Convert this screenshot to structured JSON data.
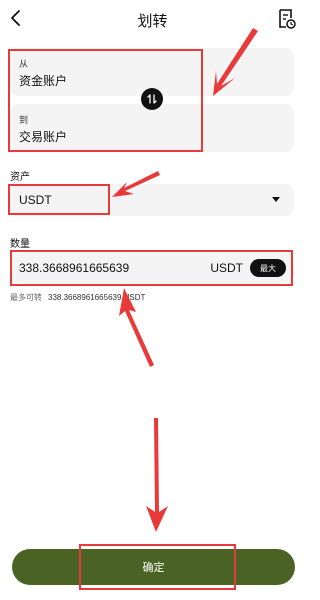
{
  "header": {
    "title": "划转",
    "back_icon": "chevron-left-icon",
    "record_icon": "document-clock-icon"
  },
  "from": {
    "label": "从",
    "account": "资金账户"
  },
  "to": {
    "label": "到",
    "account": "交易账户"
  },
  "swap": {
    "icon": "swap-vertical-icon"
  },
  "asset": {
    "label": "资产",
    "value": "USDT",
    "dropdown_icon": "caret-down-icon"
  },
  "quantity": {
    "label": "数量",
    "value": "338.3668961665639",
    "unit": "USDT",
    "max_label": "最大"
  },
  "available": {
    "label": "最多可转",
    "value": "338.3668961665639 USDT"
  },
  "confirm": {
    "label": "确定"
  },
  "colors": {
    "accent": "#4a6325",
    "annotation": "#e83a3a",
    "field_bg": "#f4f4f4"
  }
}
